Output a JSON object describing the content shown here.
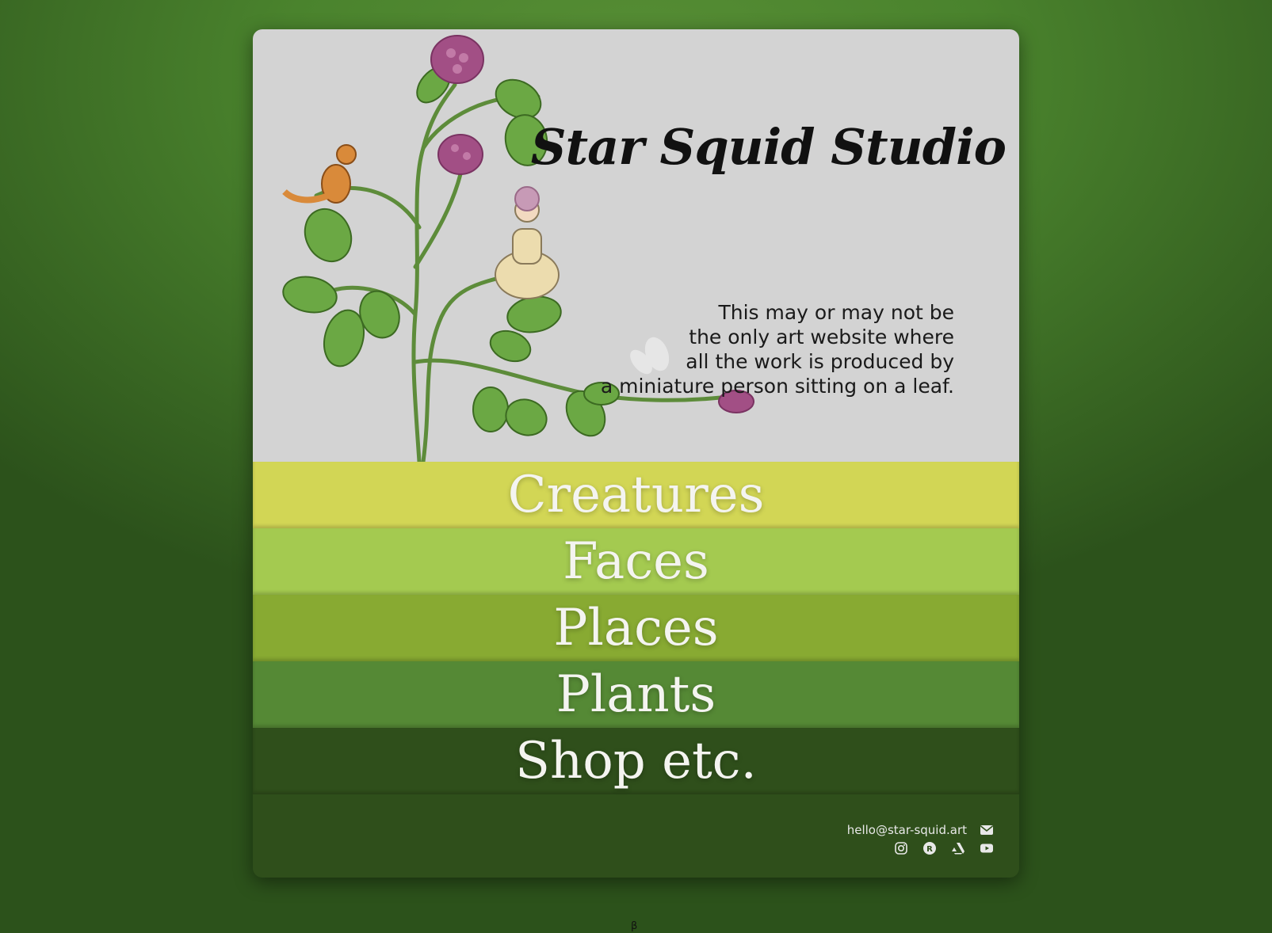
{
  "site": {
    "title": "Star Squid Studio"
  },
  "tagline": {
    "lines": [
      "This may or may not be",
      "the only art website where",
      "all the work is produced by",
      "a miniature person sitting on a leaf."
    ]
  },
  "nav": {
    "items": [
      {
        "label": "Creatures",
        "color": "#d2d655"
      },
      {
        "label": "Faces",
        "color": "#a4ca50"
      },
      {
        "label": "Places",
        "color": "#88aa32"
      },
      {
        "label": "Plants",
        "color": "#558935"
      },
      {
        "label": "Shop etc.",
        "color": "#2f4f1b"
      }
    ]
  },
  "footer": {
    "email": "hello@star-squid.art",
    "icons": [
      "instagram-icon",
      "redbubble-icon",
      "artstation-icon",
      "youtube-icon"
    ]
  },
  "beta_mark": "β",
  "colors": {
    "hero_bg": "#d3d3d3",
    "page_bg": "#4a832d"
  }
}
